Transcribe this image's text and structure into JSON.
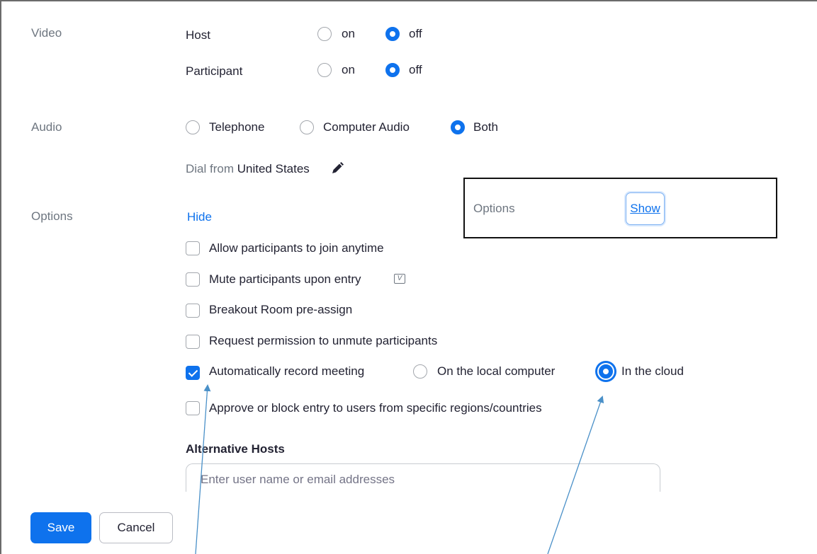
{
  "video": {
    "label": "Video",
    "host_label": "Host",
    "participant_label": "Participant",
    "on_label": "on",
    "off_label": "off",
    "host_value": "off",
    "participant_value": "off"
  },
  "audio": {
    "label": "Audio",
    "options": [
      "Telephone",
      "Computer Audio",
      "Both"
    ],
    "selected": "Both",
    "dial_from_prefix": "Dial from",
    "dial_from_country": "United States",
    "edit_icon": "pencil-icon"
  },
  "options": {
    "label": "Options",
    "hide_link": "Hide",
    "items": [
      {
        "label": "Allow participants to join anytime",
        "checked": false
      },
      {
        "label": "Mute participants upon entry",
        "checked": false,
        "icon": "video-help-icon"
      },
      {
        "label": "Breakout Room pre-assign",
        "checked": false
      },
      {
        "label": "Request permission to unmute participants",
        "checked": false
      },
      {
        "label": "Automatically record meeting",
        "checked": true
      },
      {
        "label": "Approve or block entry to users from specific regions/countries",
        "checked": false
      }
    ],
    "record_locations": [
      "On the local computer",
      "In the cloud"
    ],
    "record_selected": "In the cloud"
  },
  "callout": {
    "label": "Options",
    "show_link": "Show"
  },
  "alternative_hosts": {
    "heading": "Alternative Hosts",
    "placeholder": "Enter user name or email addresses",
    "value": ""
  },
  "footer": {
    "save_label": "Save",
    "cancel_label": "Cancel"
  },
  "colors": {
    "accent": "#0e72ed",
    "annotation_arrow": "#4a90c8"
  }
}
